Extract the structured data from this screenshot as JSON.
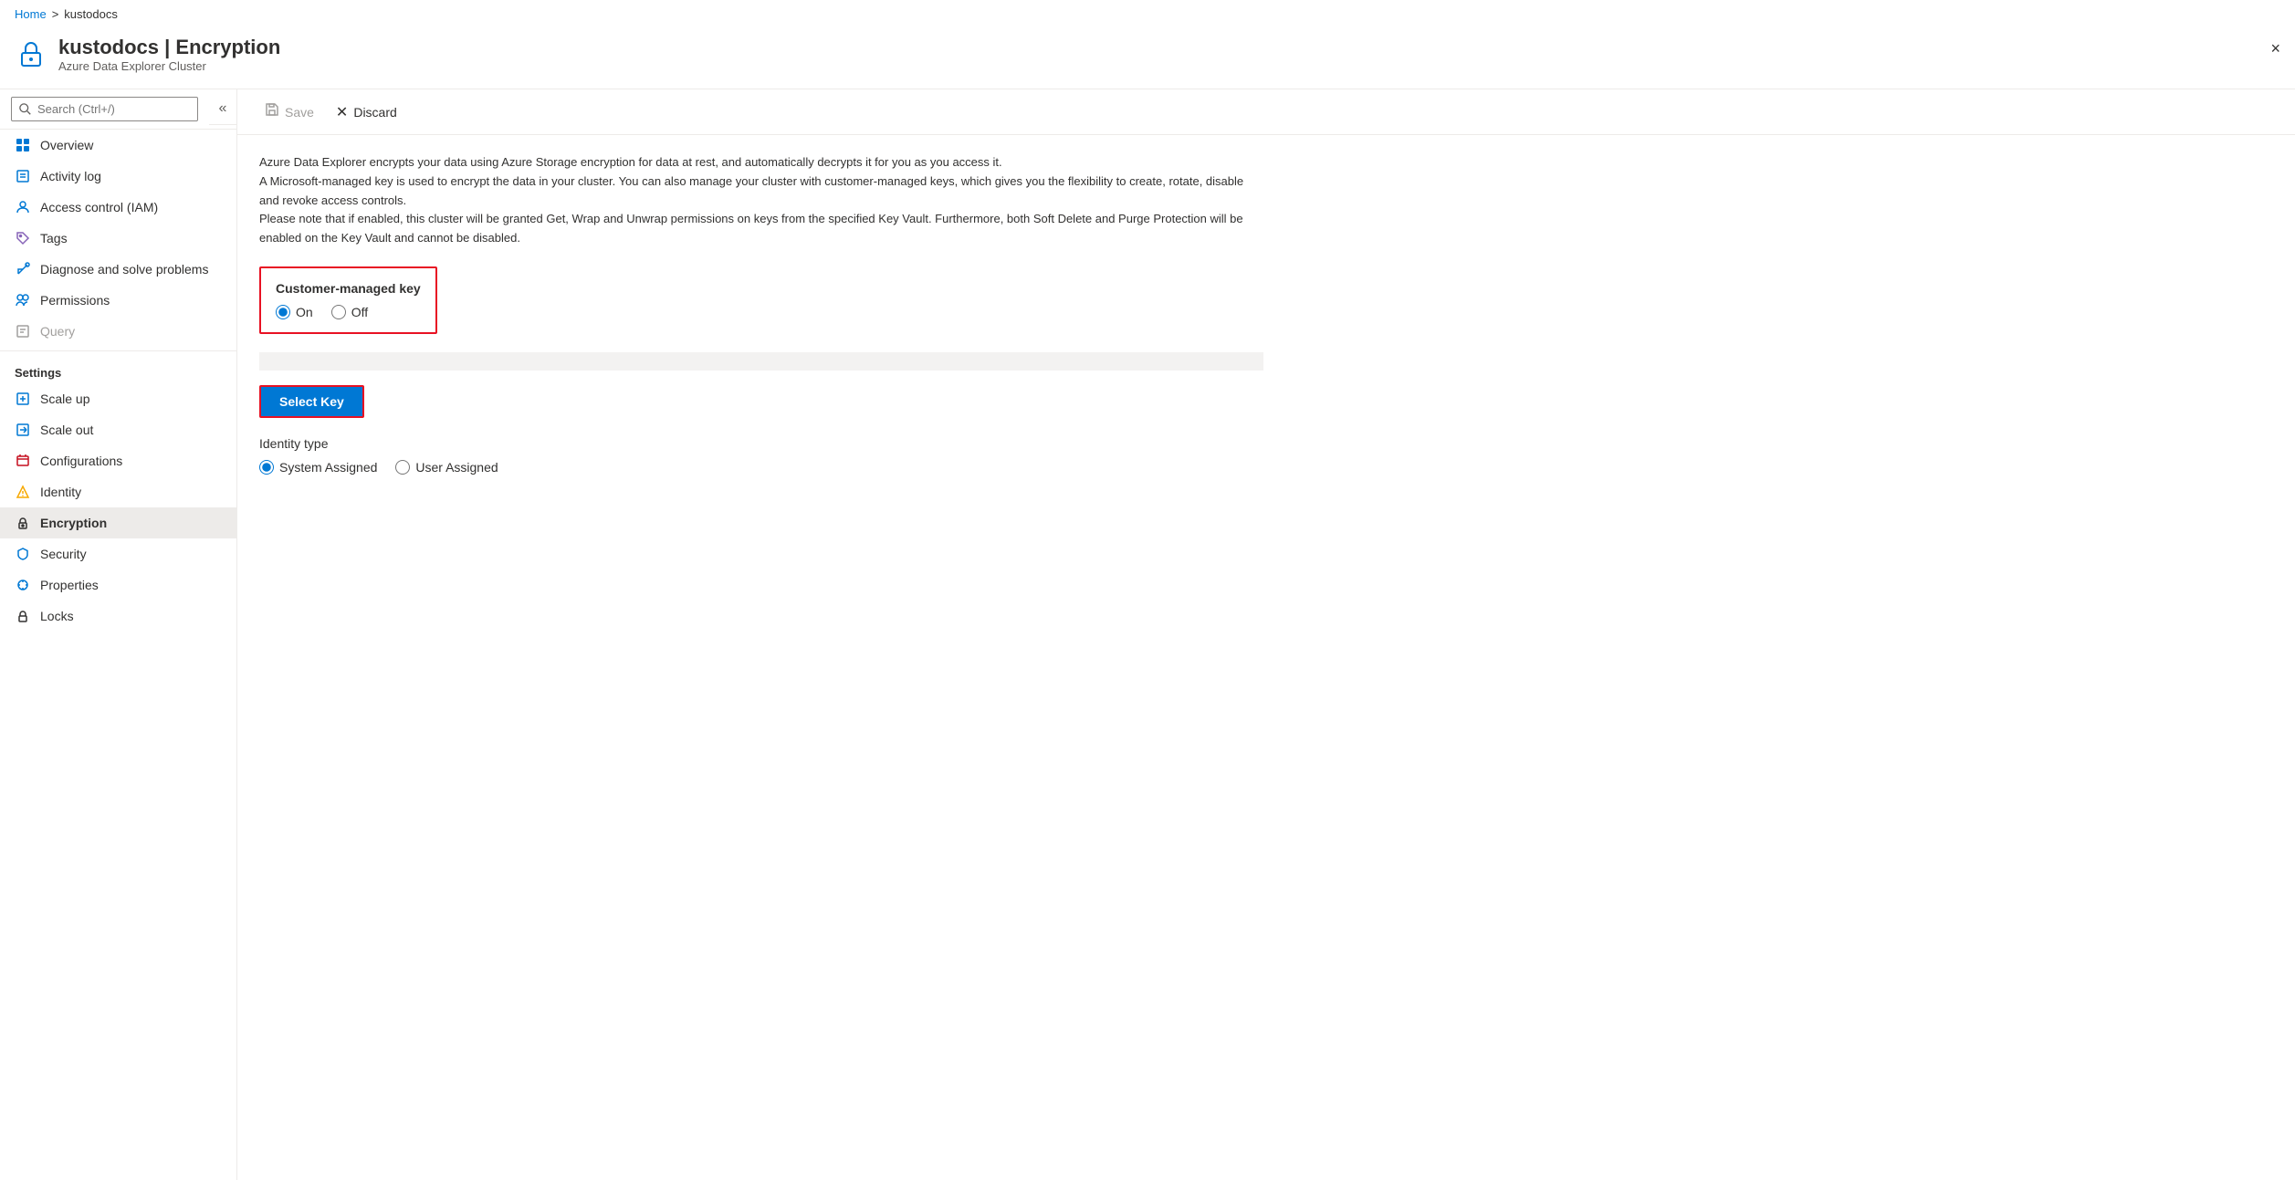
{
  "breadcrumb": {
    "home": "Home",
    "separator": ">",
    "current": "kustodocs"
  },
  "header": {
    "title": "kustodocs | Encryption",
    "subtitle": "Azure Data Explorer Cluster",
    "close_label": "×"
  },
  "sidebar": {
    "search_placeholder": "Search (Ctrl+/)",
    "collapse_icon": "«",
    "nav_items": [
      {
        "id": "overview",
        "label": "Overview",
        "icon": "grid",
        "active": false,
        "disabled": false
      },
      {
        "id": "activity-log",
        "label": "Activity log",
        "icon": "list",
        "active": false,
        "disabled": false
      },
      {
        "id": "iam",
        "label": "Access control (IAM)",
        "icon": "person",
        "active": false,
        "disabled": false
      },
      {
        "id": "tags",
        "label": "Tags",
        "icon": "tag",
        "active": false,
        "disabled": false
      },
      {
        "id": "diagnose",
        "label": "Diagnose and solve problems",
        "icon": "wrench",
        "active": false,
        "disabled": false
      },
      {
        "id": "permissions",
        "label": "Permissions",
        "icon": "people",
        "active": false,
        "disabled": false
      },
      {
        "id": "query",
        "label": "Query",
        "icon": "query",
        "active": false,
        "disabled": true
      }
    ],
    "settings_header": "Settings",
    "settings_items": [
      {
        "id": "scale-up",
        "label": "Scale up",
        "icon": "scaleup",
        "active": false,
        "disabled": false
      },
      {
        "id": "scale-out",
        "label": "Scale out",
        "icon": "scaleout",
        "active": false,
        "disabled": false
      },
      {
        "id": "configurations",
        "label": "Configurations",
        "icon": "config",
        "active": false,
        "disabled": false
      },
      {
        "id": "identity",
        "label": "Identity",
        "icon": "identity",
        "active": false,
        "disabled": false
      },
      {
        "id": "encryption",
        "label": "Encryption",
        "icon": "encrypt",
        "active": true,
        "disabled": false
      },
      {
        "id": "security",
        "label": "Security",
        "icon": "security",
        "active": false,
        "disabled": false
      },
      {
        "id": "properties",
        "label": "Properties",
        "icon": "properties",
        "active": false,
        "disabled": false
      },
      {
        "id": "locks",
        "label": "Locks",
        "icon": "locks",
        "active": false,
        "disabled": false
      }
    ]
  },
  "toolbar": {
    "save_label": "Save",
    "discard_label": "Discard"
  },
  "content": {
    "description_line1": "Azure Data Explorer encrypts your data using Azure Storage encryption for data at rest, and automatically decrypts it for you as you access it.",
    "description_line2": "A Microsoft-managed key is used to encrypt the data in your cluster. You can also manage your cluster with customer-managed keys, which gives you the flexibility to create, rotate, disable and revoke access controls.",
    "description_line3": "Please note that if enabled, this cluster will be granted Get, Wrap and Unwrap permissions on keys from the specified Key Vault. Furthermore, both Soft Delete and Purge Protection will be enabled on the Key Vault and cannot be disabled.",
    "cmk": {
      "label": "Customer-managed key",
      "on_label": "On",
      "off_label": "Off",
      "selected": "on"
    },
    "select_key_label": "Select Key",
    "identity": {
      "label": "Identity type",
      "system_label": "System Assigned",
      "user_label": "User Assigned",
      "selected": "system"
    }
  }
}
